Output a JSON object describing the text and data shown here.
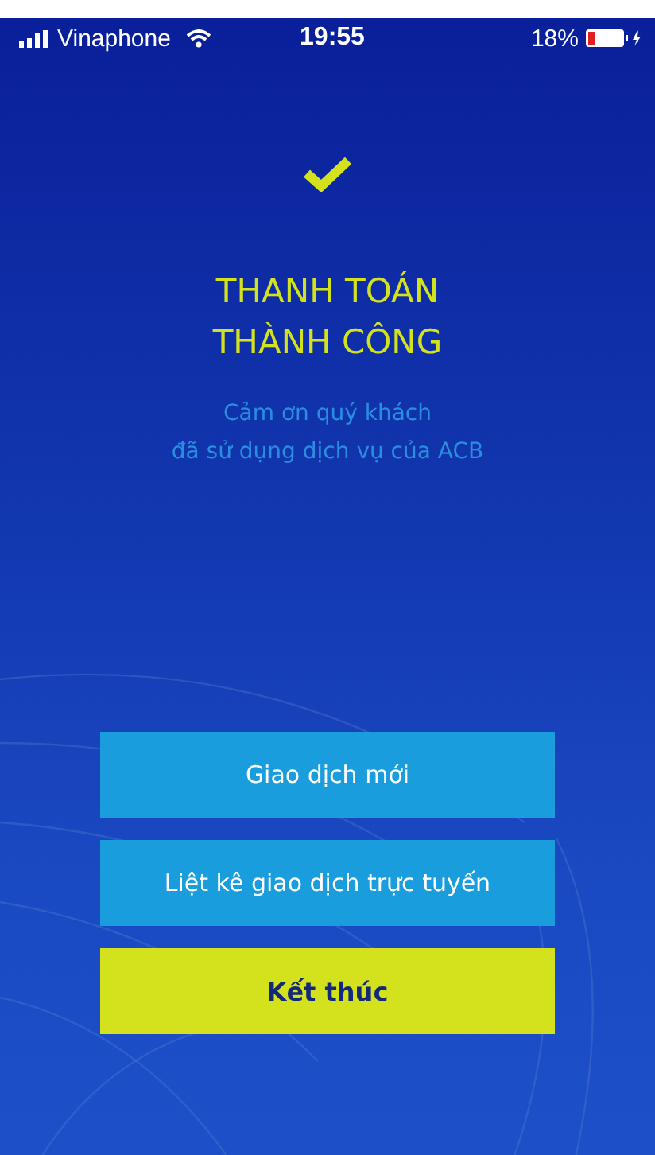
{
  "status_bar": {
    "carrier": "Vinaphone",
    "time": "19:55",
    "battery": "18%"
  },
  "result": {
    "title": [
      "THANH TOÁN",
      "THÀNH CÔNG"
    ],
    "message": [
      "Cảm ơn quý khách",
      "đã sử dụng dịch vụ của ACB"
    ]
  },
  "buttons": [
    {
      "label": "Giao dịch mới",
      "kind": "secondary"
    },
    {
      "label": "Liệt kê giao dịch trực tuyến",
      "kind": "secondary"
    },
    {
      "label": "Kết thúc",
      "kind": "primary"
    }
  ]
}
